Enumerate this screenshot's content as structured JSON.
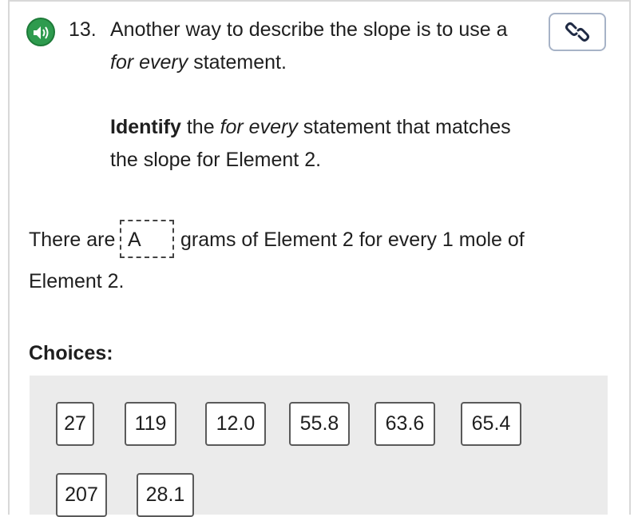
{
  "question": {
    "number": "13.",
    "line1": "Another way to describe the slope is to use a",
    "line2_italic": "for every",
    "line2_rest": " statement.",
    "instruction_bold": "Identify",
    "instruction_plain1": " the ",
    "instruction_italic": "for every",
    "instruction_plain2": " statement that matches",
    "instruction_line2": "the slope for Element 2."
  },
  "icons": {
    "audio": "speaker-icon",
    "link": "link-icon"
  },
  "sentence": {
    "prefix": "There are",
    "blank_value": "A",
    "suffix": "grams of Element 2 for every 1 mole of",
    "line2": "Element 2."
  },
  "choices": {
    "label": "Choices:",
    "items": [
      "27",
      "119",
      "12.0",
      "55.8",
      "63.6",
      "65.4",
      "207",
      "28.1"
    ]
  },
  "colors": {
    "audio_green": "#2e9b4e",
    "panel_gray": "#ebebeb"
  }
}
